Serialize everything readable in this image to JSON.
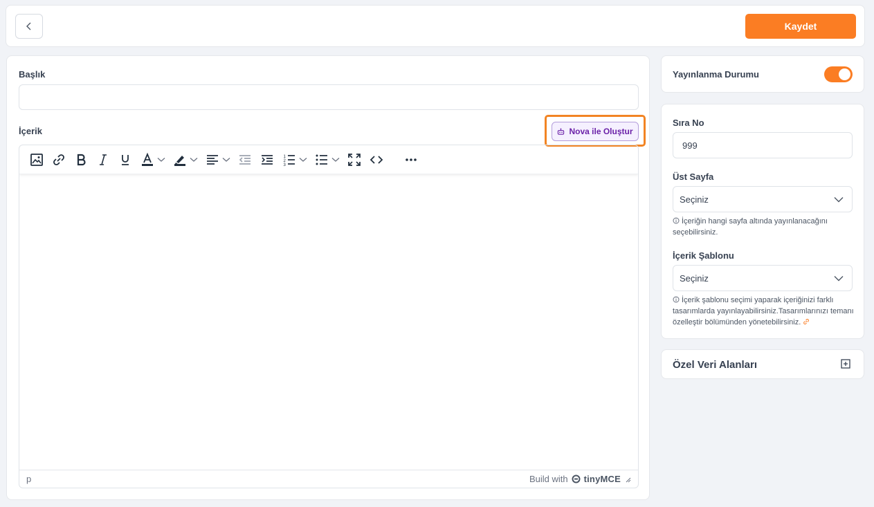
{
  "header": {
    "back_icon": "chevron-left-icon",
    "save_label": "Kaydet",
    "accent": "#fb7d23"
  },
  "form": {
    "title_label": "Başlık",
    "title_value": "",
    "content_label": "İçerik",
    "nova_button_label": "Nova ile Oluştur",
    "nova_icon": "robot-icon"
  },
  "editor": {
    "toolbar": [
      {
        "name": "image-icon"
      },
      {
        "name": "link-icon"
      },
      {
        "name": "bold-icon"
      },
      {
        "name": "italic-icon"
      },
      {
        "name": "underline-icon"
      },
      {
        "name": "text-color-icon"
      },
      {
        "name": "highlight-icon"
      },
      {
        "name": "align-icon"
      },
      {
        "name": "outdent-icon"
      },
      {
        "name": "indent-icon"
      },
      {
        "name": "numbered-list-icon"
      },
      {
        "name": "bullet-list-icon"
      },
      {
        "name": "fullscreen-icon"
      },
      {
        "name": "code-icon"
      },
      {
        "name": "more-icon"
      }
    ],
    "status_path": "p",
    "brand_prefix": "Build with",
    "brand_name": "tinyMCE"
  },
  "sidebar": {
    "publish": {
      "label": "Yayınlanma Durumu",
      "enabled": true
    },
    "order": {
      "label": "Sıra No",
      "value": "999"
    },
    "parent_page": {
      "label": "Üst Sayfa",
      "selected": "Seçiniz",
      "help": "İçeriğin hangi sayfa altında yayınlanacağını seçebilirsiniz."
    },
    "template": {
      "label": "İçerik Şablonu",
      "selected": "Seçiniz",
      "help": "İçerik şablonu seçimi yaparak içeriğinizi farklı tasarımlarda yayınlayabilirsiniz.Tasarımlarınızı temanı özelleştir bölümünden yönetebilirsiniz."
    },
    "custom_fields": {
      "label": "Özel Veri Alanları"
    }
  }
}
